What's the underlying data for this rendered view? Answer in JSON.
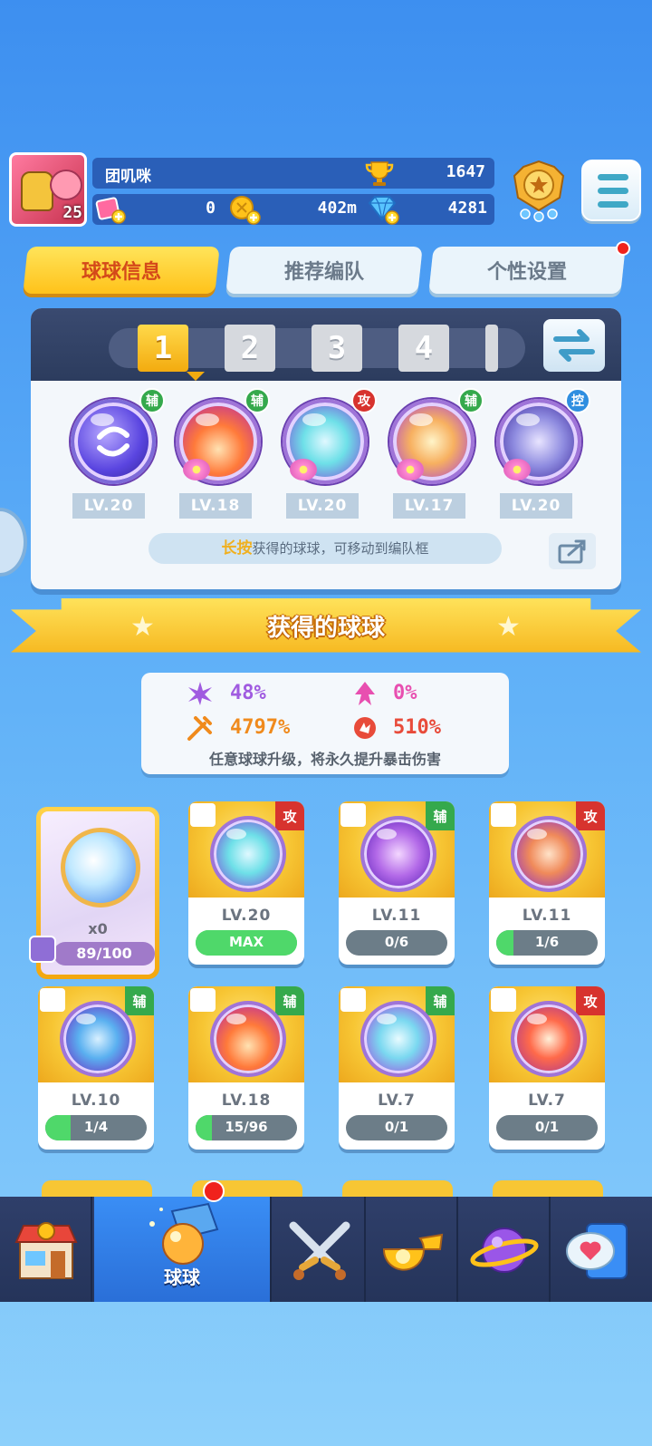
{
  "player": {
    "name": "团叽咪",
    "level": "25",
    "trophies": "1647",
    "tickets": "0",
    "distance": "402m",
    "gems": "4281"
  },
  "tabs": [
    {
      "label": "球球信息"
    },
    {
      "label": "推荐编队"
    },
    {
      "label": "个性设置"
    }
  ],
  "team": {
    "slots": [
      "1",
      "2",
      "3",
      "4"
    ],
    "active_slot": "1",
    "members": [
      {
        "type": "辅",
        "level": "LV.20"
      },
      {
        "type": "辅",
        "level": "LV.18"
      },
      {
        "type": "攻",
        "level": "LV.20"
      },
      {
        "type": "辅",
        "level": "LV.17"
      },
      {
        "type": "控",
        "level": "LV.20"
      }
    ],
    "hint_highlight": "长按",
    "hint_text": "获得的球球，可移动到编队框"
  },
  "section_title": "获得的球球",
  "stats": {
    "crit_rate": "48%",
    "speed": "0%",
    "crit_damage": "4797%",
    "power": "510%",
    "note": "任意球球升级，将永久提升暴击伤害"
  },
  "special_card": {
    "count": "x0",
    "progress": "89/100"
  },
  "cards": [
    {
      "type": "攻",
      "level": "LV.20",
      "progress": "MAX",
      "fill": 1.0
    },
    {
      "type": "辅",
      "level": "LV.11",
      "progress": "0/6",
      "fill": 0.0
    },
    {
      "type": "攻",
      "level": "LV.11",
      "progress": "1/6",
      "fill": 0.17
    },
    {
      "type": "辅",
      "level": "LV.10",
      "progress": "1/4",
      "fill": 0.25
    },
    {
      "type": "辅",
      "level": "LV.18",
      "progress": "15/96",
      "fill": 0.16
    },
    {
      "type": "辅",
      "level": "LV.7",
      "progress": "0/1",
      "fill": 0.0
    },
    {
      "type": "攻",
      "level": "LV.7",
      "progress": "0/1",
      "fill": 0.0
    }
  ],
  "nav": {
    "active_label": "球球"
  },
  "colors": {
    "accent": "#ffc21a",
    "support": "#35a94c",
    "attack": "#d7332e",
    "control": "#2f8ee0"
  }
}
